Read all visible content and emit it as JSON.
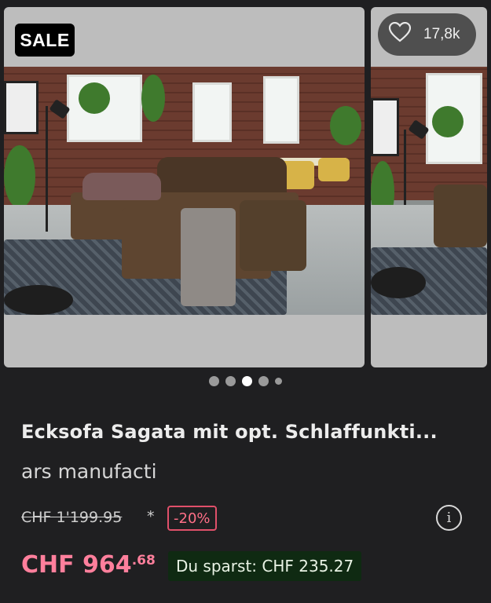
{
  "product": {
    "badge": "SALE",
    "likes": "17,8k",
    "title": "Ecksofa Sagata mit opt. Schlaffunkti...",
    "brand": "ars manufacti",
    "old_price": "CHF 1'199.95",
    "asterisk": "*",
    "discount": "-20%",
    "price_main": "CHF 964",
    "price_cents": ".68",
    "savings": "Du sparst: CHF 235.27"
  },
  "carousel": {
    "dots": 5,
    "active_index": 2
  },
  "icons": {
    "like": "heart-icon",
    "info": "info-icon"
  },
  "colors": {
    "price": "#ff7f9c",
    "discount": "#ff6f87",
    "savings_bg": "#0f2a12"
  }
}
